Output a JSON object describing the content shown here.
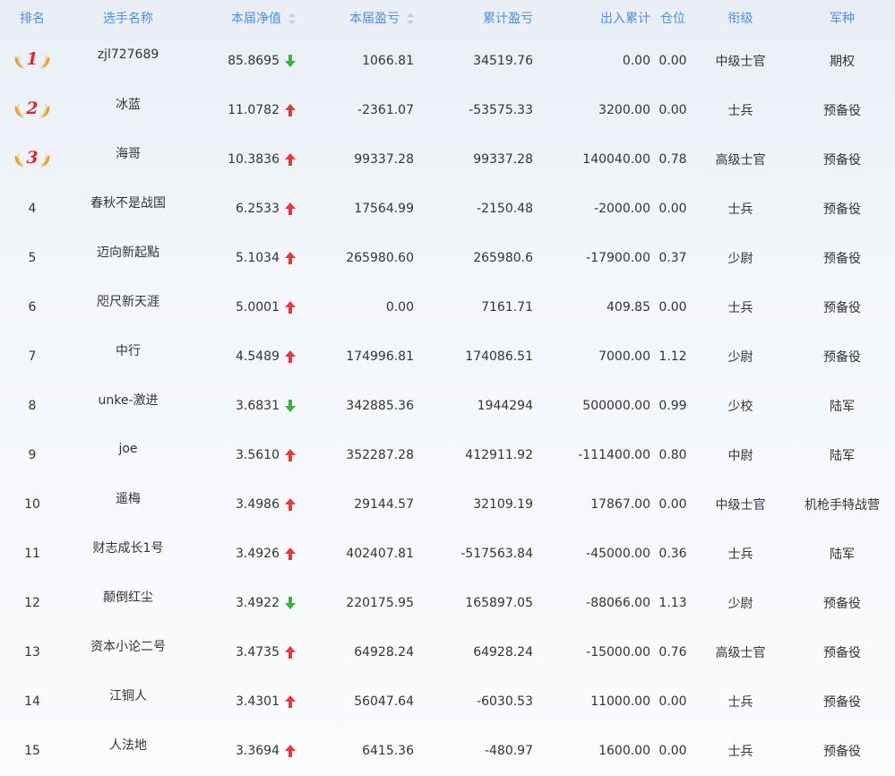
{
  "columns": {
    "rank": "排名",
    "name": "选手名称",
    "nav": "本届净值",
    "pl": "本届盈亏",
    "cum": "累计盈亏",
    "flow": "出入累计",
    "pos": "仓位",
    "title": "衔级",
    "branch": "军种"
  },
  "colors": {
    "header_text": "#4f8fda",
    "up": "#e23b3b",
    "down": "#3db04a",
    "medal_gold": "#d9a23d",
    "medal_number": "#d42d2d"
  },
  "rows": [
    {
      "rank": "1",
      "medal": true,
      "name": "zjl727689",
      "nav": "85.8695",
      "trend": "down",
      "pl": "1066.81",
      "cum": "34519.76",
      "flow": "0.00",
      "pos": "0.00",
      "title": "中级士官",
      "branch": "期权"
    },
    {
      "rank": "2",
      "medal": true,
      "name": "冰蓝",
      "nav": "11.0782",
      "trend": "up",
      "pl": "-2361.07",
      "cum": "-53575.33",
      "flow": "3200.00",
      "pos": "0.00",
      "title": "士兵",
      "branch": "预备役"
    },
    {
      "rank": "3",
      "medal": true,
      "name": "海哥",
      "nav": "10.3836",
      "trend": "up",
      "pl": "99337.28",
      "cum": "99337.28",
      "flow": "140040.00",
      "pos": "0.78",
      "title": "高级士官",
      "branch": "预备役"
    },
    {
      "rank": "4",
      "medal": false,
      "name": "春秋不是战国",
      "nav": "6.2533",
      "trend": "up",
      "pl": "17564.99",
      "cum": "-2150.48",
      "flow": "-2000.00",
      "pos": "0.00",
      "title": "士兵",
      "branch": "预备役"
    },
    {
      "rank": "5",
      "medal": false,
      "name": "迈向新起點",
      "nav": "5.1034",
      "trend": "up",
      "pl": "265980.60",
      "cum": "265980.6",
      "flow": "-17900.00",
      "pos": "0.37",
      "title": "少尉",
      "branch": "预备役"
    },
    {
      "rank": "6",
      "medal": false,
      "name": "咫尺新天涯",
      "nav": "5.0001",
      "trend": "up",
      "pl": "0.00",
      "cum": "7161.71",
      "flow": "409.85",
      "pos": "0.00",
      "title": "士兵",
      "branch": "预备役"
    },
    {
      "rank": "7",
      "medal": false,
      "name": "中行",
      "nav": "4.5489",
      "trend": "up",
      "pl": "174996.81",
      "cum": "174086.51",
      "flow": "7000.00",
      "pos": "1.12",
      "title": "少尉",
      "branch": "预备役"
    },
    {
      "rank": "8",
      "medal": false,
      "name": "unke-激进",
      "nav": "3.6831",
      "trend": "down",
      "pl": "342885.36",
      "cum": "1944294",
      "flow": "500000.00",
      "pos": "0.99",
      "title": "少校",
      "branch": "陆军"
    },
    {
      "rank": "9",
      "medal": false,
      "name": "joe",
      "nav": "3.5610",
      "trend": "up",
      "pl": "352287.28",
      "cum": "412911.92",
      "flow": "-111400.00",
      "pos": "0.80",
      "title": "中尉",
      "branch": "陆军"
    },
    {
      "rank": "10",
      "medal": false,
      "name": "遥梅",
      "nav": "3.4986",
      "trend": "up",
      "pl": "29144.57",
      "cum": "32109.19",
      "flow": "17867.00",
      "pos": "0.00",
      "title": "中级士官",
      "branch": "机枪手特战营"
    },
    {
      "rank": "11",
      "medal": false,
      "name": "财志成长1号",
      "nav": "3.4926",
      "trend": "up",
      "pl": "402407.81",
      "cum": "-517563.84",
      "flow": "-45000.00",
      "pos": "0.36",
      "title": "士兵",
      "branch": "陆军"
    },
    {
      "rank": "12",
      "medal": false,
      "name": "颠倒红尘",
      "nav": "3.4922",
      "trend": "down",
      "pl": "220175.95",
      "cum": "165897.05",
      "flow": "-88066.00",
      "pos": "1.13",
      "title": "少尉",
      "branch": "预备役"
    },
    {
      "rank": "13",
      "medal": false,
      "name": "资本小论二号",
      "nav": "3.4735",
      "trend": "up",
      "pl": "64928.24",
      "cum": "64928.24",
      "flow": "-15000.00",
      "pos": "0.76",
      "title": "高级士官",
      "branch": "预备役"
    },
    {
      "rank": "14",
      "medal": false,
      "name": "江铜人",
      "nav": "3.4301",
      "trend": "up",
      "pl": "56047.64",
      "cum": "-6030.53",
      "flow": "11000.00",
      "pos": "0.00",
      "title": "士兵",
      "branch": "预备役"
    },
    {
      "rank": "15",
      "medal": false,
      "name": "人法地",
      "nav": "3.3694",
      "trend": "up",
      "pl": "6415.36",
      "cum": "-480.97",
      "flow": "1600.00",
      "pos": "0.00",
      "title": "士兵",
      "branch": "预备役"
    }
  ]
}
